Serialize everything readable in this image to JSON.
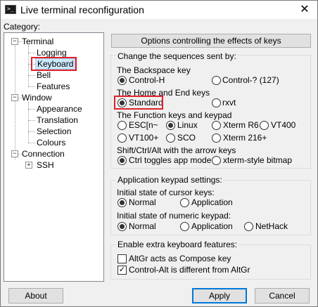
{
  "window": {
    "title": "Live terminal reconfiguration",
    "close": "✕"
  },
  "category_label": "Category:",
  "tree": {
    "terminal": "Terminal",
    "logging": "Logging",
    "keyboard": "Keyboard",
    "bell": "Bell",
    "features": "Features",
    "window": "Window",
    "appearance": "Appearance",
    "translation": "Translation",
    "selection": "Selection",
    "colours": "Colours",
    "connection": "Connection",
    "ssh": "SSH",
    "expanded_sign": "−",
    "collapsed_sign": "+"
  },
  "panel": {
    "header": "Options controlling the effects of keys",
    "seq_group": "Change the sequences sent by:",
    "backspace": {
      "label": "The Backspace key",
      "options": [
        "Control-H",
        "Control-? (127)"
      ],
      "selected": "Control-H"
    },
    "homeend": {
      "label": "The Home and End keys",
      "options": [
        "Standard",
        "rxvt"
      ],
      "selected": "Standard"
    },
    "function": {
      "label": "The Function keys and keypad",
      "options": [
        "ESC[n~",
        "Linux",
        "Xterm R6",
        "VT400",
        "VT100+",
        "SCO",
        "Xterm 216+"
      ],
      "selected": "Linux"
    },
    "shift": {
      "label": "Shift/Ctrl/Alt with the arrow keys",
      "options": [
        "Ctrl toggles app mode",
        "xterm-style bitmap"
      ],
      "selected": "Ctrl toggles app mode"
    },
    "appkeypad_group": "Application keypad settings:",
    "cursor": {
      "label": "Initial state of cursor keys:",
      "options": [
        "Normal",
        "Application"
      ],
      "selected": "Normal"
    },
    "numeric": {
      "label": "Initial state of numeric keypad:",
      "options": [
        "Normal",
        "Application",
        "NetHack"
      ],
      "selected": "Normal"
    },
    "extra_group": "Enable extra keyboard features:",
    "altgr": {
      "label": "AltGr acts as Compose key",
      "checked": false
    },
    "ctrlalt": {
      "label": "Control-Alt is different from AltGr",
      "checked": true
    }
  },
  "buttons": {
    "about": "About",
    "apply": "Apply",
    "cancel": "Cancel"
  },
  "check_mark": "✓",
  "colors": {
    "highlight": "#e0212b",
    "selection": "#cce8ff",
    "default_button_border": "#0078d7"
  }
}
